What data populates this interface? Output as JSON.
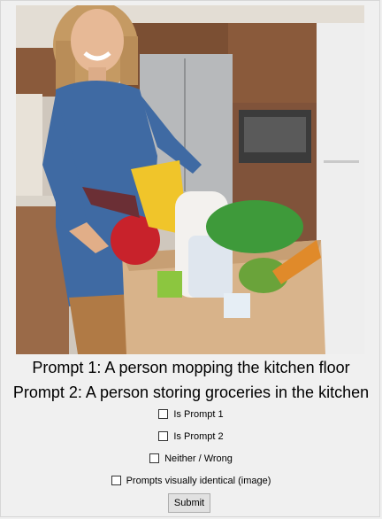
{
  "photo": {
    "subject": "smiling woman holding paper grocery bag in kitchen",
    "colors": {
      "shirt": "#3f6aa3",
      "bag": "#d8b38a",
      "cabinet": "#8a5a3b",
      "fridge": "#e9e9e9"
    }
  },
  "prompts": {
    "prompt1": "Prompt 1: A person mopping the kitchen floor",
    "prompt2": "Prompt 2: A person storing groceries in the kitchen"
  },
  "options": [
    {
      "label": "Is Prompt 1",
      "checked": false
    },
    {
      "label": "Is Prompt 2",
      "checked": false
    },
    {
      "label": "Neither / Wrong",
      "checked": false
    },
    {
      "label": "Prompts visually identical (image)",
      "checked": false
    }
  ],
  "submit_label": "Submit"
}
